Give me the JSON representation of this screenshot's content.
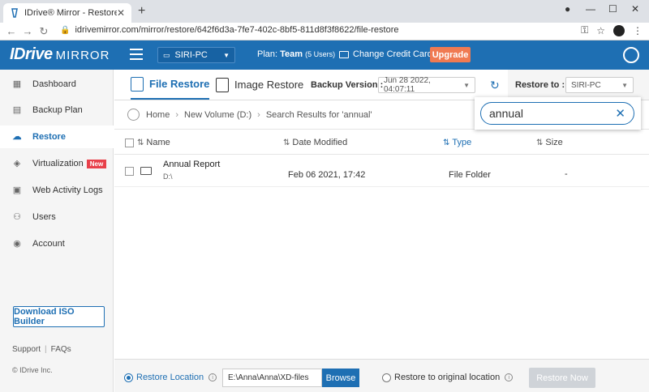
{
  "browser": {
    "tab_title": "IDrive® Mirror - Restore",
    "tab_close": "✕",
    "new_tab": "+",
    "url": "idrivemirror.com/mirror/restore/642f6d3a-7fe7-402c-8bf5-811d8f3f8622/file-restore",
    "window_controls": [
      "—",
      "☐",
      "✕"
    ]
  },
  "header": {
    "logo_main": "IDrive",
    "logo_sub": "MIRROR",
    "computer": "SIRI-PC",
    "plan_label": "Plan:",
    "plan_value": "Team",
    "plan_users": "(5 Users)",
    "change_card": "Change Credit Card",
    "upgrade": "Upgrade"
  },
  "sidebar": {
    "items": [
      {
        "label": "Dashboard",
        "icon": "▦"
      },
      {
        "label": "Backup Plan",
        "icon": "▤"
      },
      {
        "label": "Restore",
        "icon": "☁"
      },
      {
        "label": "Virtualization",
        "icon": "◈"
      },
      {
        "label": "Web Activity Logs",
        "icon": "▣"
      },
      {
        "label": "Users",
        "icon": "⚇"
      },
      {
        "label": "Account",
        "icon": "◉"
      }
    ],
    "new_badge": "New",
    "iso_button": "Download ISO Builder",
    "support": "Support",
    "faqs": "FAQs",
    "copyright": "© IDrive Inc."
  },
  "toolbar": {
    "tab_file": "File Restore",
    "tab_image": "Image Restore",
    "backup_version_label": "Backup Version :",
    "backup_version_value": "Jun 28 2022, 04:07:11",
    "restore_to_label": "Restore to :",
    "restore_to_value": "SIRI-PC"
  },
  "breadcrumb": {
    "home": "Home",
    "volume": "New Volume (D:)",
    "results": "Search Results for 'annual'"
  },
  "search": {
    "value": "annual"
  },
  "table": {
    "headers": {
      "name": "Name",
      "date": "Date Modified",
      "type": "Type",
      "size": "Size"
    },
    "rows": [
      {
        "name": "Annual Report",
        "path": "D:\\",
        "date": "Feb 06 2021, 17:42",
        "type": "File Folder",
        "size": "-"
      }
    ]
  },
  "footer": {
    "restore_location": "Restore Location",
    "path": "E:\\Anna\\Anna\\XD-files",
    "browse": "Browse",
    "restore_original": "Restore to original location",
    "restore_now": "Restore Now"
  },
  "colors": {
    "brand": "#1e6fb3",
    "upgrade": "#f07a52",
    "new_badge": "#e8404a"
  }
}
